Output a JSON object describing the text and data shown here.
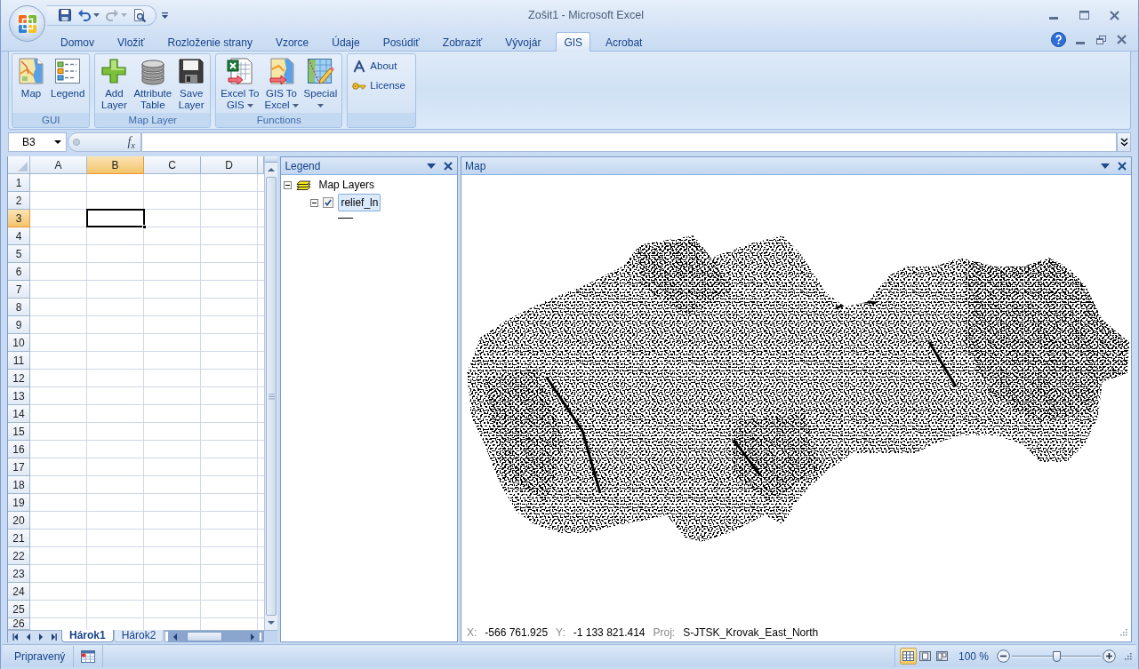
{
  "window": {
    "title": "Zošit1 - Microsoft Excel"
  },
  "quick_access": [
    {
      "dropdown": false,
      "disabled": false
    },
    {
      "dropdown": true,
      "disabled": false
    },
    {
      "dropdown": true,
      "disabled": true
    },
    {
      "dropdown": false,
      "disabled": false
    }
  ],
  "ribbon_tabs": [
    {
      "label": "Domov",
      "selected": false
    },
    {
      "label": "Vložiť",
      "selected": false
    },
    {
      "label": "Rozloženie strany",
      "selected": false
    },
    {
      "label": "Vzorce",
      "selected": false
    },
    {
      "label": "Údaje",
      "selected": false
    },
    {
      "label": "Posúdiť",
      "selected": false
    },
    {
      "label": "Zobraziť",
      "selected": false
    },
    {
      "label": "Vývojár",
      "selected": false
    },
    {
      "label": "GIS",
      "selected": true
    },
    {
      "label": "Acrobat",
      "selected": false
    }
  ],
  "ribbon_groups": [
    {
      "label": "GUI",
      "buttons": [
        {
          "kind": "large",
          "lines": [
            "Map"
          ],
          "dropdown": false
        },
        {
          "kind": "large",
          "lines": [
            "Legend"
          ],
          "dropdown": false
        }
      ]
    },
    {
      "label": "Map Layer",
      "buttons": [
        {
          "kind": "large",
          "lines": [
            "Add",
            "Layer"
          ],
          "dropdown": false
        },
        {
          "kind": "large",
          "lines": [
            "Attribute",
            "Table"
          ],
          "dropdown": false
        },
        {
          "kind": "large",
          "lines": [
            "Save",
            "Layer"
          ],
          "dropdown": false
        }
      ]
    },
    {
      "label": "Functions",
      "buttons": [
        {
          "kind": "large",
          "lines": [
            "Excel To",
            "GIS"
          ],
          "dropdown": true
        },
        {
          "kind": "large",
          "lines": [
            "GIS To",
            "Excel"
          ],
          "dropdown": true
        },
        {
          "kind": "large",
          "lines": [
            "Special"
          ],
          "dropdown": true
        }
      ]
    },
    {
      "buttons": [
        {
          "kind": "small",
          "lines": [
            "About"
          ],
          "dropdown": false
        },
        {
          "kind": "small",
          "lines": [
            "License"
          ],
          "dropdown": false
        }
      ]
    }
  ],
  "formula_bar": {
    "name_box": "B3",
    "function_button": "f$_{x}$"
  },
  "sheet": {
    "columns": [
      {
        "label": "A",
        "selected": false
      },
      {
        "label": "B",
        "selected": true
      },
      {
        "label": "C",
        "selected": false
      },
      {
        "label": "D",
        "selected": false
      }
    ],
    "rows": [
      {
        "label": "1",
        "selected": false
      },
      {
        "label": "2",
        "selected": false
      },
      {
        "label": "3",
        "selected": true
      },
      {
        "label": "4",
        "selected": false
      },
      {
        "label": "5",
        "selected": false
      },
      {
        "label": "6",
        "selected": false
      },
      {
        "label": "7",
        "selected": false
      },
      {
        "label": "8",
        "selected": false
      },
      {
        "label": "9",
        "selected": false
      },
      {
        "label": "10",
        "selected": false
      },
      {
        "label": "11",
        "selected": false
      },
      {
        "label": "12",
        "selected": false
      },
      {
        "label": "13",
        "selected": false
      },
      {
        "label": "14",
        "selected": false
      },
      {
        "label": "15",
        "selected": false
      },
      {
        "label": "16",
        "selected": false
      },
      {
        "label": "17",
        "selected": false
      },
      {
        "label": "18",
        "selected": false
      },
      {
        "label": "19",
        "selected": false
      },
      {
        "label": "20",
        "selected": false
      },
      {
        "label": "21",
        "selected": false
      },
      {
        "label": "22",
        "selected": false
      },
      {
        "label": "23",
        "selected": false
      },
      {
        "label": "24",
        "selected": false
      },
      {
        "label": "25",
        "selected": false
      },
      {
        "label": "26",
        "selected": false
      }
    ],
    "tabs": [
      {
        "label": "Hárok1",
        "selected": true
      },
      {
        "label": "Hárok2",
        "selected": false
      }
    ]
  },
  "legend": {
    "title": "Legend",
    "tree": [
      {
        "kind": "group",
        "label": "Map Layers",
        "expanded": true,
        "children": [
          {
            "kind": "layer",
            "label": "relief_ln",
            "expanded": true,
            "checked": true,
            "selected": true
          }
        ]
      }
    ]
  },
  "map": {
    "title": "Map",
    "coordinates": [
      {
        "label": "X:",
        "value": "-566 761.925"
      },
      {
        "label": "Y:",
        "value": "-1 133 821.414"
      },
      {
        "label": "Proj:",
        "value": "S-JTSK_Krovak_East_North"
      }
    ]
  },
  "status_bar": {
    "text": "Pripravený",
    "views": [
      {
        "selected": true
      },
      {
        "selected": false
      },
      {
        "selected": false
      }
    ],
    "zoom": {
      "label": "100 %",
      "level": 0.5
    }
  }
}
